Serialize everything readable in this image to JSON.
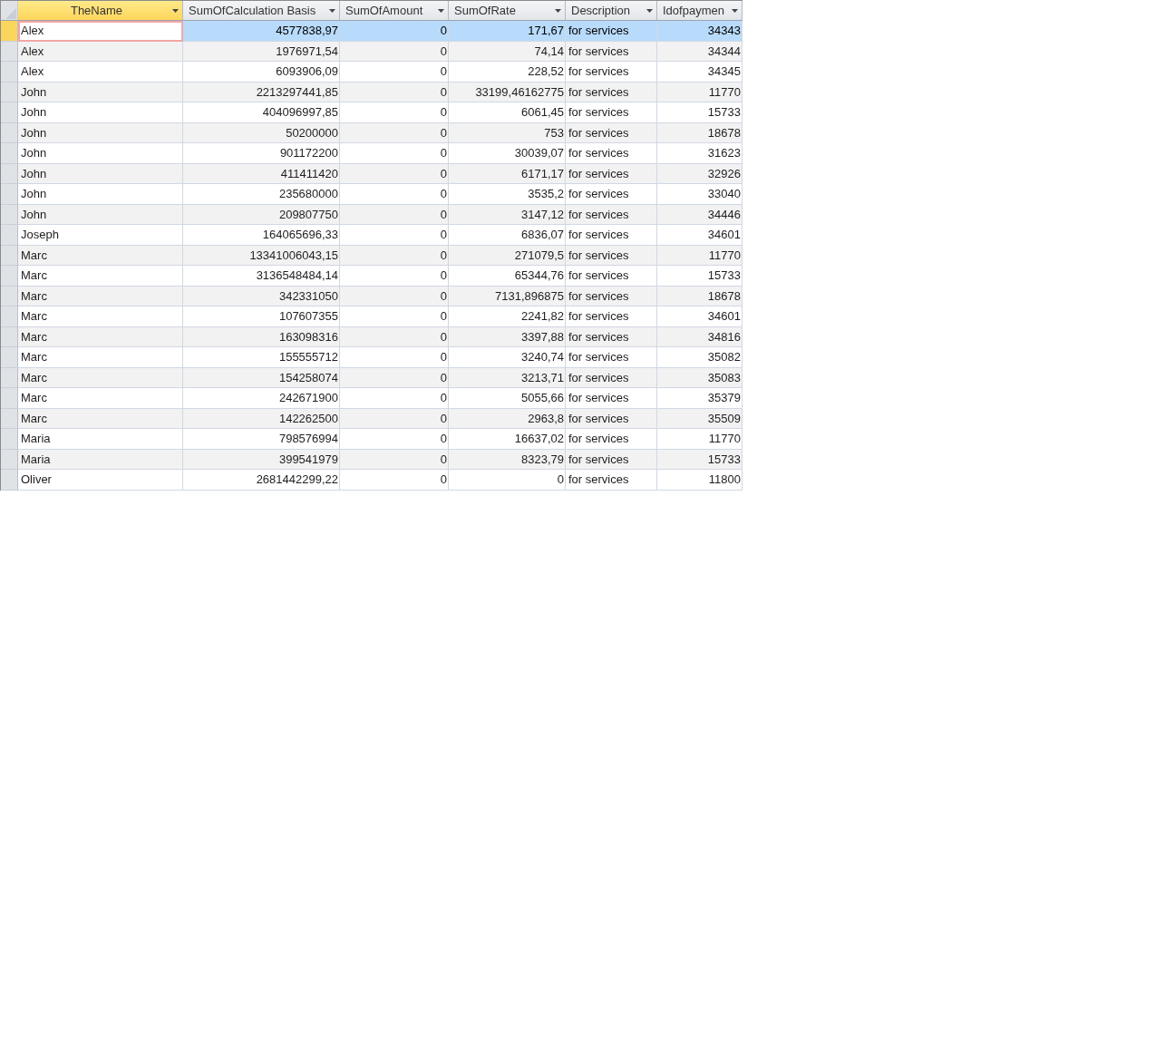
{
  "columns": [
    {
      "label": "TheName",
      "kind": "text",
      "selected": true
    },
    {
      "label": "SumOfCalculation Basis",
      "kind": "number",
      "selected": false
    },
    {
      "label": "SumOfAmount",
      "kind": "number",
      "selected": false
    },
    {
      "label": "SumOfRate",
      "kind": "number",
      "selected": false
    },
    {
      "label": "Description",
      "kind": "text",
      "selected": false
    },
    {
      "label": "Idofpaymen",
      "kind": "number",
      "selected": false
    }
  ],
  "rows": [
    {
      "selected": true,
      "cells": [
        "Alex",
        "4577838,97",
        "0",
        "171,67",
        "for services",
        "34343"
      ]
    },
    {
      "selected": false,
      "cells": [
        "Alex",
        "1976971,54",
        "0",
        "74,14",
        "for services",
        "34344"
      ]
    },
    {
      "selected": false,
      "cells": [
        "Alex",
        "6093906,09",
        "0",
        "228,52",
        "for services",
        "34345"
      ]
    },
    {
      "selected": false,
      "cells": [
        "John",
        "2213297441,85",
        "0",
        "33199,46162775",
        "for services",
        "11770"
      ]
    },
    {
      "selected": false,
      "cells": [
        "John",
        "404096997,85",
        "0",
        "6061,45",
        "for services",
        "15733"
      ]
    },
    {
      "selected": false,
      "cells": [
        "John",
        "50200000",
        "0",
        "753",
        "for services",
        "18678"
      ]
    },
    {
      "selected": false,
      "cells": [
        "John",
        "901172200",
        "0",
        "30039,07",
        "for services",
        "31623"
      ]
    },
    {
      "selected": false,
      "cells": [
        "John",
        "411411420",
        "0",
        "6171,17",
        "for services",
        "32926"
      ]
    },
    {
      "selected": false,
      "cells": [
        "John",
        "235680000",
        "0",
        "3535,2",
        "for services",
        "33040"
      ]
    },
    {
      "selected": false,
      "cells": [
        "John",
        "209807750",
        "0",
        "3147,12",
        "for services",
        "34446"
      ]
    },
    {
      "selected": false,
      "cells": [
        "Joseph",
        "164065696,33",
        "0",
        "6836,07",
        "for services",
        "34601"
      ]
    },
    {
      "selected": false,
      "cells": [
        "Marc",
        "13341006043,15",
        "0",
        "271079,5",
        "for services",
        "11770"
      ]
    },
    {
      "selected": false,
      "cells": [
        "Marc",
        "3136548484,14",
        "0",
        "65344,76",
        "for services",
        "15733"
      ]
    },
    {
      "selected": false,
      "cells": [
        "Marc",
        "342331050",
        "0",
        "7131,896875",
        "for services",
        "18678"
      ]
    },
    {
      "selected": false,
      "cells": [
        "Marc",
        "107607355",
        "0",
        "2241,82",
        "for services",
        "34601"
      ]
    },
    {
      "selected": false,
      "cells": [
        "Marc",
        "163098316",
        "0",
        "3397,88",
        "for services",
        "34816"
      ]
    },
    {
      "selected": false,
      "cells": [
        "Marc",
        "155555712",
        "0",
        "3240,74",
        "for services",
        "35082"
      ]
    },
    {
      "selected": false,
      "cells": [
        "Marc",
        "154258074",
        "0",
        "3213,71",
        "for services",
        "35083"
      ]
    },
    {
      "selected": false,
      "cells": [
        "Marc",
        "242671900",
        "0",
        "5055,66",
        "for services",
        "35379"
      ]
    },
    {
      "selected": false,
      "cells": [
        "Marc",
        "142262500",
        "0",
        "2963,8",
        "for services",
        "35509"
      ]
    },
    {
      "selected": false,
      "cells": [
        "Maria",
        "798576994",
        "0",
        "16637,02",
        "for services",
        "11770"
      ]
    },
    {
      "selected": false,
      "cells": [
        "Maria",
        "399541979",
        "0",
        "8323,79",
        "for services",
        "15733"
      ]
    },
    {
      "selected": false,
      "cells": [
        "Oliver",
        "2681442299,22",
        "0",
        "0",
        "for services",
        "11800"
      ]
    }
  ]
}
